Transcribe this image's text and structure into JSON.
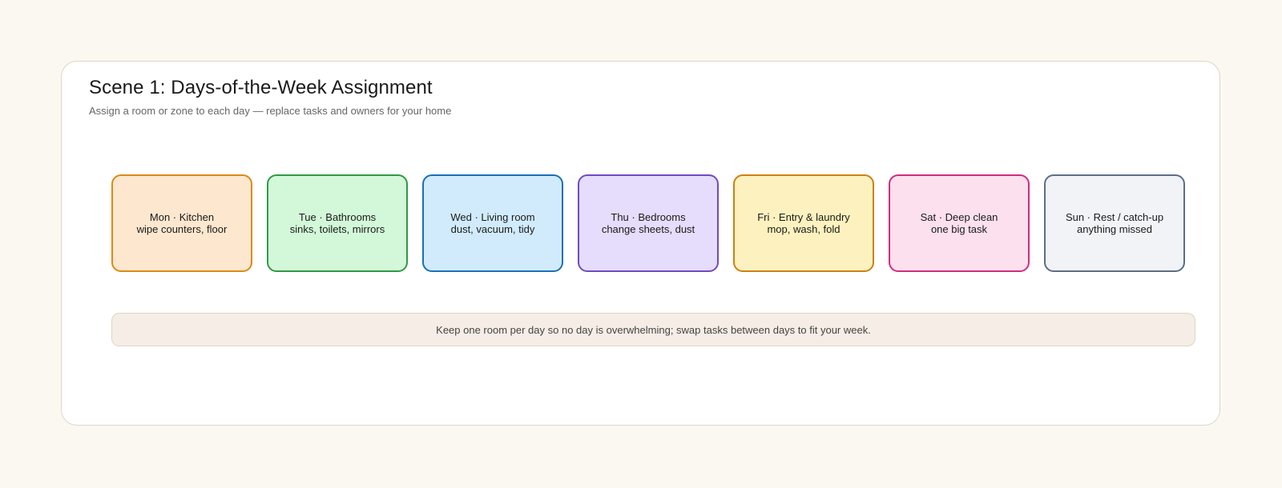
{
  "header": {
    "title": "Scene 1: Days-of-the-Week Assignment",
    "subtitle": "Assign a room or zone to each day — replace tasks and owners for your home"
  },
  "days": [
    {
      "label": "Mon · Kitchen",
      "tasks": "wipe counters, floor",
      "fill": "#fde7cf",
      "border": "#dc8a14"
    },
    {
      "label": "Tue · Bathrooms",
      "tasks": "sinks, toilets, mirrors",
      "fill": "#d3f8d9",
      "border": "#2f9a44"
    },
    {
      "label": "Wed · Living room",
      "tasks": "dust, vacuum, tidy",
      "fill": "#d1ebfc",
      "border": "#1b6fb8"
    },
    {
      "label": "Thu · Bedrooms",
      "tasks": "change sheets, dust",
      "fill": "#e6dcfc",
      "border": "#6f4bc4"
    },
    {
      "label": "Fri · Entry & laundry",
      "tasks": "mop, wash, fold",
      "fill": "#fdf2bf",
      "border": "#d07f12"
    },
    {
      "label": "Sat · Deep clean",
      "tasks": "one big task",
      "fill": "#fde0ee",
      "border": "#d12c7e"
    },
    {
      "label": "Sun · Rest / catch-up",
      "tasks": "anything missed",
      "fill": "#f1f3f6",
      "border": "#5d6c88"
    }
  ],
  "note": "Keep one room per day so no day is overwhelming; swap tasks between days to fit your week."
}
